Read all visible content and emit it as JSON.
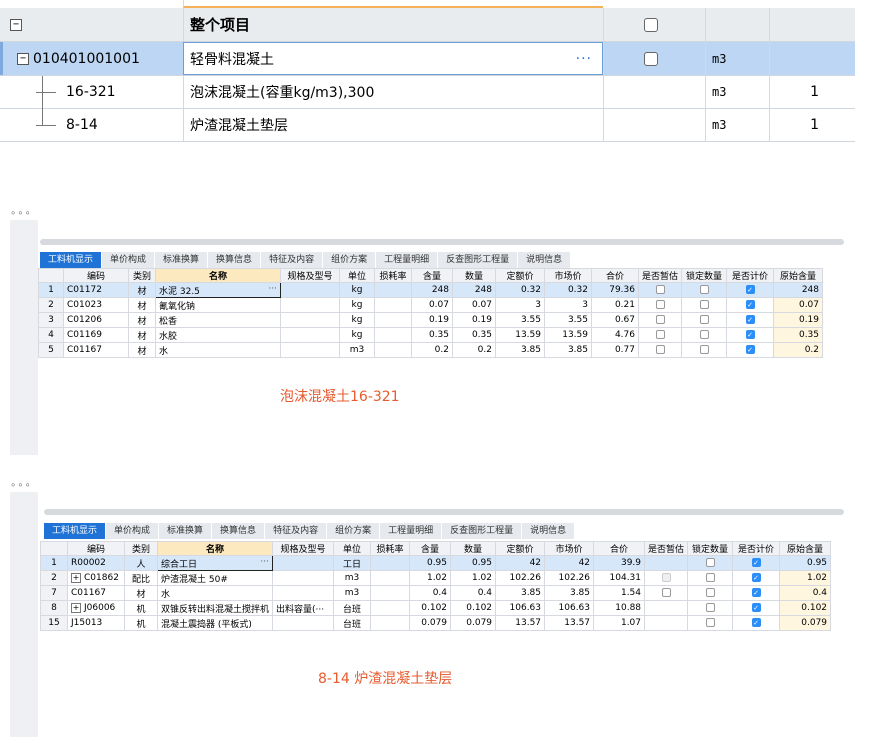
{
  "top_grid": {
    "rows": [
      {
        "code": "",
        "name": "整个项目",
        "unit": "",
        "qty": "",
        "check": false
      },
      {
        "code": "010401001001",
        "name": "轻骨料混凝土",
        "unit": "m3",
        "qty": "",
        "check": false
      },
      {
        "code": "16-321",
        "name": "泡沫混凝土(容重kg/m3),300",
        "unit": "m3",
        "qty": "1"
      },
      {
        "code": "8-14",
        "name": "炉渣混凝土垫层",
        "unit": "m3",
        "qty": "1"
      }
    ],
    "ellipsis": "···",
    "tree_minus": "−"
  },
  "tabs": [
    "工料机显示",
    "单价构成",
    "标准换算",
    "换算信息",
    "特征及内容",
    "组价方案",
    "工程量明细",
    "反查图形工程量",
    "说明信息"
  ],
  "columns": [
    "编码",
    "类别",
    "名称",
    "规格及型号",
    "单位",
    "损耗率",
    "含量",
    "数量",
    "定额价",
    "市场价",
    "合价",
    "是否暂估",
    "锁定数量",
    "是否计价",
    "原始含量"
  ],
  "panel1": {
    "caption": "泡沫混凝土16-321",
    "rows": [
      {
        "ix": "1",
        "code": "C01172",
        "cat": "材",
        "name": "水泥 32.5",
        "spec": "",
        "unit": "kg",
        "loss": "",
        "content": "248",
        "qty": "248",
        "quota": "0.32",
        "market": "0.32",
        "total": "79.36",
        "est": "off",
        "lock": "off",
        "price": "on",
        "orig": "248"
      },
      {
        "ix": "2",
        "code": "C01023",
        "cat": "材",
        "name": "氰氧化钠",
        "spec": "",
        "unit": "kg",
        "loss": "",
        "content": "0.07",
        "qty": "0.07",
        "quota": "3",
        "market": "3",
        "total": "0.21",
        "est": "off",
        "lock": "off",
        "price": "on",
        "orig": "0.07"
      },
      {
        "ix": "3",
        "code": "C01206",
        "cat": "材",
        "name": "松香",
        "spec": "",
        "unit": "kg",
        "loss": "",
        "content": "0.19",
        "qty": "0.19",
        "quota": "3.55",
        "market": "3.55",
        "total": "0.67",
        "est": "off",
        "lock": "off",
        "price": "on",
        "orig": "0.19"
      },
      {
        "ix": "4",
        "code": "C01169",
        "cat": "材",
        "name": "水胶",
        "spec": "",
        "unit": "kg",
        "loss": "",
        "content": "0.35",
        "qty": "0.35",
        "quota": "13.59",
        "market": "13.59",
        "total": "4.76",
        "est": "off",
        "lock": "off",
        "price": "on",
        "orig": "0.35"
      },
      {
        "ix": "5",
        "code": "C01167",
        "cat": "材",
        "name": "水",
        "spec": "",
        "unit": "m3",
        "loss": "",
        "content": "0.2",
        "qty": "0.2",
        "quota": "3.85",
        "market": "3.85",
        "total": "0.77",
        "est": "off",
        "lock": "off",
        "price": "on",
        "orig": "0.2"
      }
    ]
  },
  "panel2": {
    "caption": "8-14 炉渣混凝土垫层",
    "rows": [
      {
        "ix": "1",
        "code": "R00002",
        "cat": "人",
        "name": "综合工日",
        "spec": "",
        "unit": "工日",
        "loss": "",
        "content": "0.95",
        "qty": "0.95",
        "quota": "42",
        "market": "42",
        "total": "39.9",
        "est": "none",
        "lock": "off",
        "price": "on",
        "orig": "0.95",
        "tree": ""
      },
      {
        "ix": "2",
        "code": "C01862",
        "cat": "配比",
        "name": "炉渣混凝土 50#",
        "spec": "",
        "unit": "m3",
        "loss": "",
        "content": "1.02",
        "qty": "1.02",
        "quota": "102.26",
        "market": "102.26",
        "total": "104.31",
        "est": "dis",
        "lock": "off",
        "price": "on",
        "orig": "1.02",
        "tree": "+"
      },
      {
        "ix": "7",
        "code": "C01167",
        "cat": "材",
        "name": "水",
        "spec": "",
        "unit": "m3",
        "loss": "",
        "content": "0.4",
        "qty": "0.4",
        "quota": "3.85",
        "market": "3.85",
        "total": "1.54",
        "est": "off",
        "lock": "off",
        "price": "on",
        "orig": "0.4",
        "tree": ""
      },
      {
        "ix": "8",
        "code": "J06006",
        "cat": "机",
        "name": "双锥反转出料混凝土搅拌机",
        "spec": "出料容量(···",
        "unit": "台班",
        "loss": "",
        "content": "0.102",
        "qty": "0.102",
        "quota": "106.63",
        "market": "106.63",
        "total": "10.88",
        "est": "none",
        "lock": "off",
        "price": "on",
        "orig": "0.102",
        "tree": "+"
      },
      {
        "ix": "15",
        "code": "J15013",
        "cat": "机",
        "name": "混凝土震捣器 (平板式)",
        "spec": "",
        "unit": "台班",
        "loss": "",
        "content": "0.079",
        "qty": "0.079",
        "quota": "13.57",
        "market": "13.57",
        "total": "1.07",
        "est": "none",
        "lock": "off",
        "price": "on",
        "orig": "0.079",
        "tree": ""
      }
    ]
  },
  "ellipsis_mark": "···",
  "dots": "∘∘∘",
  "check_mark": "✓",
  "colors": {
    "accent": "#1f73d6",
    "caption": "#e85b2f",
    "selected": "#bcd6f3"
  }
}
